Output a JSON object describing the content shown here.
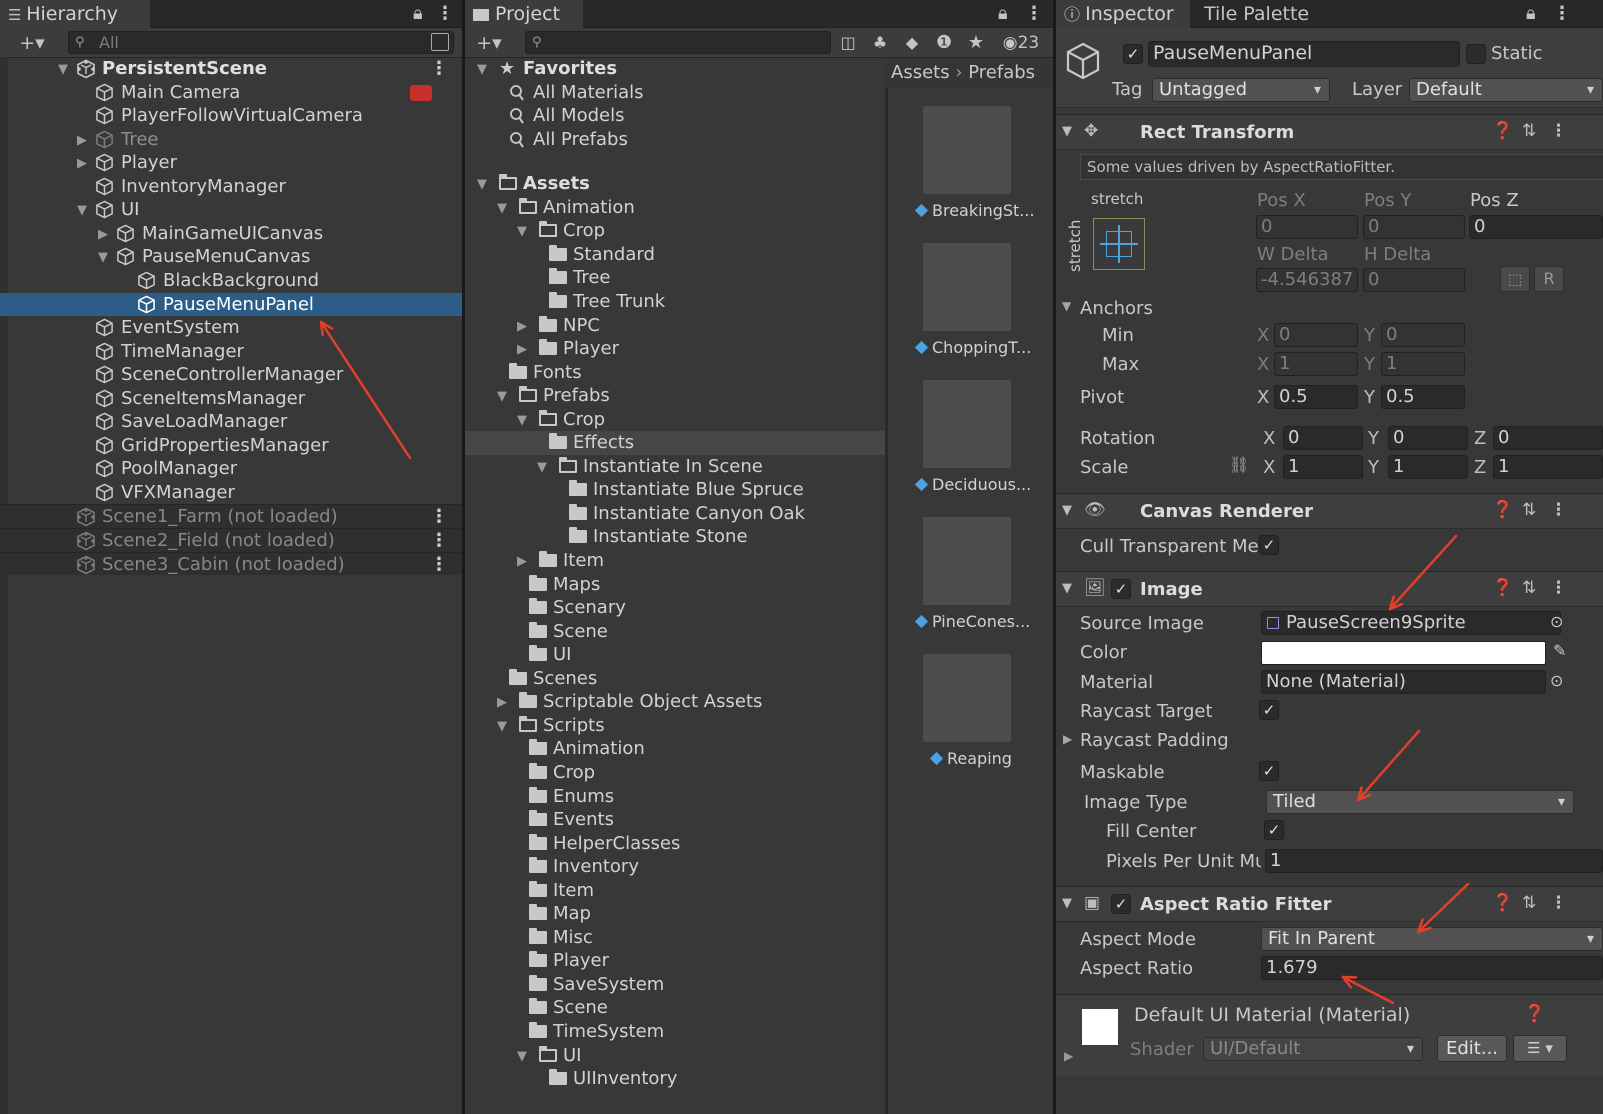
{
  "hierarchy": {
    "tab_title": "Hierarchy",
    "search_placeholder": "All",
    "rows": [
      {
        "label": "PersistentScene"
      },
      {
        "label": "Main Camera"
      },
      {
        "label": "PlayerFollowVirtualCamera"
      },
      {
        "label": "Tree"
      },
      {
        "label": "Player"
      },
      {
        "label": "InventoryManager"
      },
      {
        "label": "UI"
      },
      {
        "label": "MainGameUICanvas"
      },
      {
        "label": "PauseMenuCanvas"
      },
      {
        "label": "BlackBackground"
      },
      {
        "label": "PauseMenuPanel"
      },
      {
        "label": "EventSystem"
      },
      {
        "label": "TimeManager"
      },
      {
        "label": "SceneControllerManager"
      },
      {
        "label": "SceneItemsManager"
      },
      {
        "label": "SaveLoadManager"
      },
      {
        "label": "GridPropertiesManager"
      },
      {
        "label": "PoolManager"
      },
      {
        "label": "VFXManager"
      },
      {
        "label": "Scene1_Farm (not loaded)"
      },
      {
        "label": "Scene2_Field (not loaded)"
      },
      {
        "label": "Scene3_Cabin (not loaded)"
      }
    ]
  },
  "project": {
    "tab_title": "Project",
    "hidden_count": "23",
    "breadcrumb": [
      "Assets",
      "Prefabs"
    ],
    "tree": [
      {
        "label": "Favorites"
      },
      {
        "label": "All Materials"
      },
      {
        "label": "All Models"
      },
      {
        "label": "All Prefabs"
      },
      {
        "label": "Assets"
      },
      {
        "label": "Animation"
      },
      {
        "label": "Crop"
      },
      {
        "label": "Standard"
      },
      {
        "label": "Tree"
      },
      {
        "label": "Tree Trunk"
      },
      {
        "label": "NPC"
      },
      {
        "label": "Player"
      },
      {
        "label": "Fonts"
      },
      {
        "label": "Prefabs"
      },
      {
        "label": "Crop"
      },
      {
        "label": "Effects"
      },
      {
        "label": "Instantiate In Scene"
      },
      {
        "label": "Instantiate Blue Spruce"
      },
      {
        "label": "Instantiate Canyon Oak"
      },
      {
        "label": "Instantiate Stone"
      },
      {
        "label": "Item"
      },
      {
        "label": "Maps"
      },
      {
        "label": "Scenary"
      },
      {
        "label": "Scene"
      },
      {
        "label": "UI"
      },
      {
        "label": "Scenes"
      },
      {
        "label": "Scriptable Object Assets"
      },
      {
        "label": "Scripts"
      },
      {
        "label": "Animation"
      },
      {
        "label": "Crop"
      },
      {
        "label": "Enums"
      },
      {
        "label": "Events"
      },
      {
        "label": "HelperClasses"
      },
      {
        "label": "Inventory"
      },
      {
        "label": "Item"
      },
      {
        "label": "Map"
      },
      {
        "label": "Misc"
      },
      {
        "label": "Player"
      },
      {
        "label": "SaveSystem"
      },
      {
        "label": "Scene"
      },
      {
        "label": "TimeSystem"
      },
      {
        "label": "UI"
      },
      {
        "label": "UIInventory"
      }
    ],
    "assets": [
      "BreakingSt...",
      "ChoppingT...",
      "Deciduous...",
      "PineCones...",
      "Reaping"
    ]
  },
  "inspector": {
    "tab_title": "Inspector",
    "tab2_title": "Tile Palette",
    "object_name": "PauseMenuPanel",
    "static_label": "Static",
    "tag_label": "Tag",
    "tag_value": "Untagged",
    "layer_label": "Layer",
    "layer_value": "Default",
    "rect_transform": {
      "title": "Rect Transform",
      "note": "Some values driven by AspectRatioFitter.",
      "anchor_preset_top": "stretch",
      "anchor_preset_side": "stretch",
      "pos_x_label": "Pos X",
      "pos_y_label": "Pos Y",
      "pos_z_label": "Pos Z",
      "pos_x": "0",
      "pos_y": "0",
      "pos_z": "0",
      "w_delta_label": "W Delta",
      "h_delta_label": "H Delta",
      "w_delta": "-4.546387",
      "h_delta": "0",
      "r_button": "R",
      "anchors_label": "Anchors",
      "min_label": "Min",
      "max_label": "Max",
      "min_x": "0",
      "min_y": "0",
      "max_x": "1",
      "max_y": "1",
      "pivot_label": "Pivot",
      "pivot_x": "0.5",
      "pivot_y": "0.5",
      "rotation_label": "Rotation",
      "rot_x": "0",
      "rot_y": "0",
      "rot_z": "0",
      "scale_label": "Scale",
      "scale_x": "1",
      "scale_y": "1",
      "scale_z": "1",
      "axis_x": "X",
      "axis_y": "Y",
      "axis_z": "Z"
    },
    "canvas_renderer": {
      "title": "Canvas Renderer",
      "cull_label": "Cull Transparent Me"
    },
    "image": {
      "title": "Image",
      "source_image_label": "Source Image",
      "source_image": "PauseScreen9Sprite",
      "color_label": "Color",
      "color_value": "#ffffff",
      "material_label": "Material",
      "material": "None (Material)",
      "raycast_target_label": "Raycast Target",
      "raycast_padding_label": "Raycast Padding",
      "maskable_label": "Maskable",
      "image_type_label": "Image Type",
      "image_type": "Tiled",
      "fill_center_label": "Fill Center",
      "ppu_label": "Pixels Per Unit Mu",
      "ppu": "1"
    },
    "aspect_ratio_fitter": {
      "title": "Aspect Ratio Fitter",
      "mode_label": "Aspect Mode",
      "mode": "Fit In Parent",
      "ratio_label": "Aspect Ratio",
      "ratio": "1.679"
    },
    "material": {
      "title": "Default UI Material (Material)",
      "shader_label": "Shader",
      "shader": "UI/Default",
      "edit_button": "Edit..."
    }
  },
  "colors": {
    "selection": "#2c5d87",
    "annotation_arrow": "#e0402a"
  }
}
